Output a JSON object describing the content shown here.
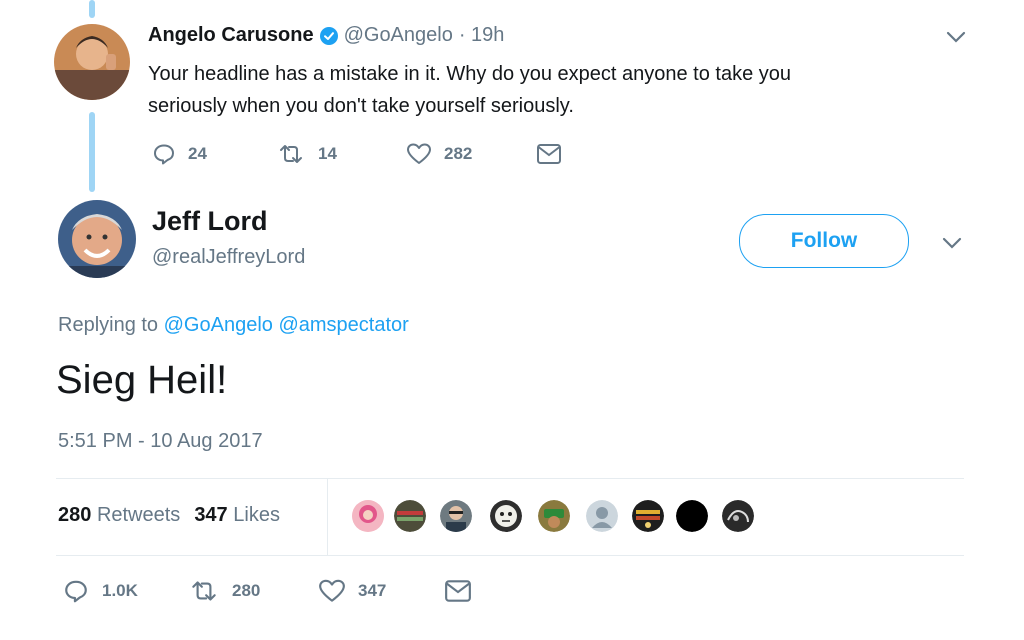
{
  "parent_tweet": {
    "author_name": "Angelo Carusone",
    "handle": "@GoAngelo",
    "time": "· 19h",
    "text_line1": "Your headline has a mistake in it. Why do you expect anyone to take you",
    "text_line2": "seriously when you don't take yourself seriously.",
    "replies": "24",
    "retweets": "14",
    "likes": "282"
  },
  "main_tweet": {
    "author_name": "Jeff Lord",
    "handle": "@realJeffreyLord",
    "follow_label": "Follow",
    "replying_prefix": "Replying to",
    "replying_to_1": "@GoAngelo",
    "replying_to_2": "@amspectator",
    "text": "Sieg Heil!",
    "timestamp": "5:51 PM - 10 Aug 2017",
    "retweet_count": "280",
    "retweet_label": "Retweets",
    "like_count": "347",
    "like_label": "Likes",
    "actions": {
      "replies": "1.0K",
      "retweets": "280",
      "likes": "347"
    }
  },
  "colors": {
    "accent": "#1da1f2",
    "muted": "#657786",
    "thread_line": "#9fd5f5",
    "verified": "#1da1f2"
  },
  "icons": [
    "verified-badge-icon",
    "chevron-down-icon",
    "reply-icon",
    "retweet-icon",
    "like-icon",
    "message-icon"
  ]
}
